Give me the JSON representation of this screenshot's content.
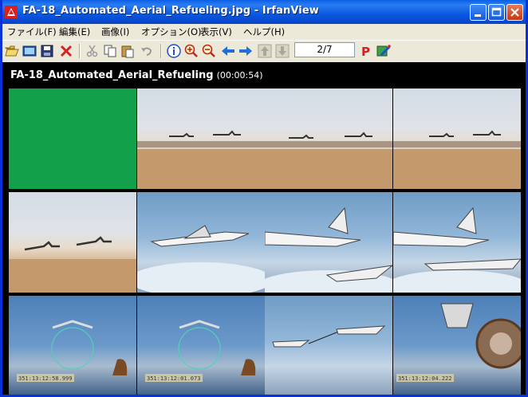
{
  "window": {
    "title": "FA-18_Automated_Aerial_Refueling.jpg - IrfanView",
    "buttons": [
      "minimize-icon",
      "maximize-icon",
      "close-icon"
    ]
  },
  "menu": [
    "ファイル(F)",
    "編集(E)",
    "画像(I)",
    "オプション(O)",
    "表示(V)",
    "ヘルプ(H)"
  ],
  "toolbar": {
    "icons": [
      "open-folder-icon",
      "slideshow-icon",
      "save-icon",
      "delete-icon",
      "cut-icon",
      "copy-icon",
      "paste-icon",
      "undo-icon",
      "info-icon",
      "zoom-in-icon",
      "zoom-out-icon",
      "previous-icon",
      "next-icon",
      "first-icon",
      "last-icon",
      "page-info",
      "paint-icon",
      "settings-icon"
    ],
    "page_counter": "2/7"
  },
  "content": {
    "video_title": "FA-18_Automated_Aerial_Refueling",
    "duration": "(00:00:54)",
    "timestamps": [
      "351:13:12:58.999",
      "351:13:12:01.073",
      "351:13:12:04.222"
    ]
  },
  "colors": {
    "green_frame": "#13a04a",
    "title_bar": "#0a5ee6"
  }
}
